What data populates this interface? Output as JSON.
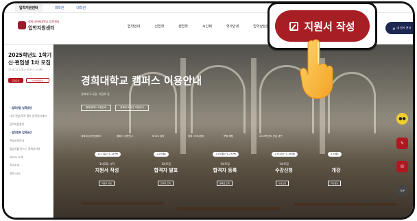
{
  "topbar": {
    "tabs": [
      "입학지원센터",
      "대학원",
      "대학원"
    ]
  },
  "logo": {
    "university": "경희사이버대학교 입학센터",
    "center": "입학지원센터"
  },
  "nav": [
    "입학안내",
    "신입학",
    "편입학",
    "시간제",
    "학과안내",
    "입학상담실"
  ],
  "mypage_label": "내 원서 관리",
  "apply_button": {
    "label": "지원서 작성",
    "icon": "pencil-icon",
    "color": "#a71e24"
  },
  "sidebar": {
    "title": "2025학년도 1학기 신·편입생 1차 모집",
    "date": "2024.12.1(일)~2025.1.14(목)",
    "pill1": "모집요강",
    "pill2": "사이버캠퍼스",
    "items": [
      {
        "label": "입학상담 입학상담",
        "head": true
      },
      {
        "label": "나의 편입/학적 평가 입학관리센터",
        "head": false
      },
      {
        "label": "입학지원절차",
        "head": false
      },
      {
        "label": "입학정보 입학요강",
        "head": true
      },
      {
        "label": "전형과목안내",
        "head": false
      },
      {
        "label": "졸업자를 반드는 경희사이버",
        "head": false
      },
      {
        "label": "MKCU 소개",
        "head": false
      },
      {
        "label": "학과소개",
        "head": false
      },
      {
        "label": "경희 SNS",
        "head": false
      }
    ]
  },
  "hero": {
    "title": "경희대학교 캠퍼스 이용안내",
    "subtitle": "경희대 도서관, 이용료 등",
    "buttons": [
      "경희캠퍼스 이용안내",
      "경희대 도서관 이용안내"
    ],
    "links": [
      "경희대 온라인캠퍼스",
      "캠퍼스 이용안내",
      "KHCU 강좌",
      "경희 스터디센터",
      "문화 체험",
      "2025학년도 신입 생안"
    ]
  },
  "cards": [
    {
      "date": "12.1(일)~1.14(목)",
      "sub": "1차모집 시작",
      "title": "지원서 작성",
      "btn": "지원서 작성"
    },
    {
      "date": "1.20(월)",
      "sub": "1차모집",
      "title": "합격자 발표",
      "btn": "합격자 조회"
    },
    {
      "date": "1.20(월)~1.23(목)",
      "sub": "1차모집",
      "title": "합격자 등록",
      "btn": "등록금 조회"
    },
    {
      "date": "1.31(금)~2.18(월)",
      "sub": "1차모집",
      "title": "수강신청",
      "btn": "수강신청"
    },
    {
      "date": "3.3(월)",
      "sub": "",
      "title": "개강",
      "btn": "학사일정"
    }
  ],
  "floating": {
    "chat": "chat-icon",
    "apply": "note-icon",
    "consult": "consult-icon",
    "top": "TOP"
  }
}
